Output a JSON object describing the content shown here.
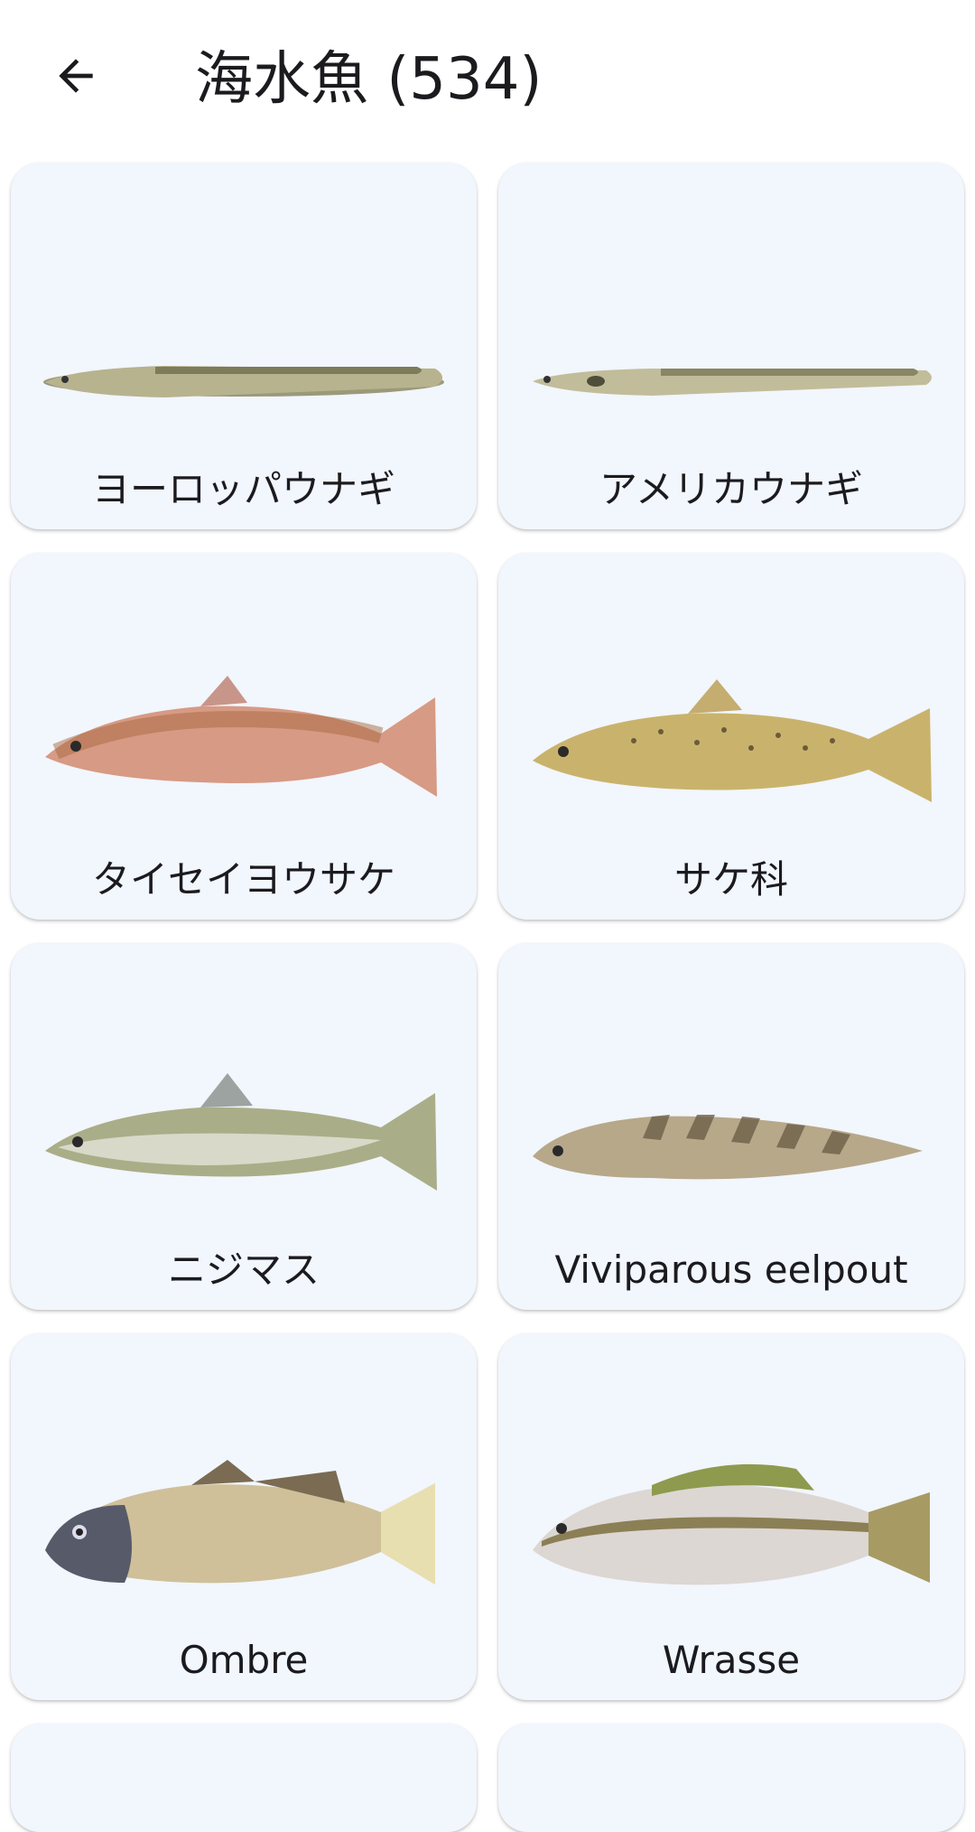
{
  "header": {
    "title": "海水魚 (534)",
    "back_icon": "arrow-left-icon"
  },
  "cards": [
    {
      "label": "ヨーロッパウナギ",
      "image": "eel-illustration"
    },
    {
      "label": "アメリカウナギ",
      "image": "eel-illustration"
    },
    {
      "label": "タイセイヨウサケ",
      "image": "salmon-illustration"
    },
    {
      "label": "サケ科",
      "image": "trout-illustration"
    },
    {
      "label": "ニジマス",
      "image": "rainbow-trout-illustration"
    },
    {
      "label": "Viviparous eelpout",
      "image": "eelpout-illustration"
    },
    {
      "label": "Ombre",
      "image": "meagre-illustration"
    },
    {
      "label": "Wrasse",
      "image": "perch-like-illustration"
    }
  ],
  "colors": {
    "card_bg": "#f2f6fd",
    "page_bg": "#ffffff",
    "text": "#1b1b1f"
  }
}
